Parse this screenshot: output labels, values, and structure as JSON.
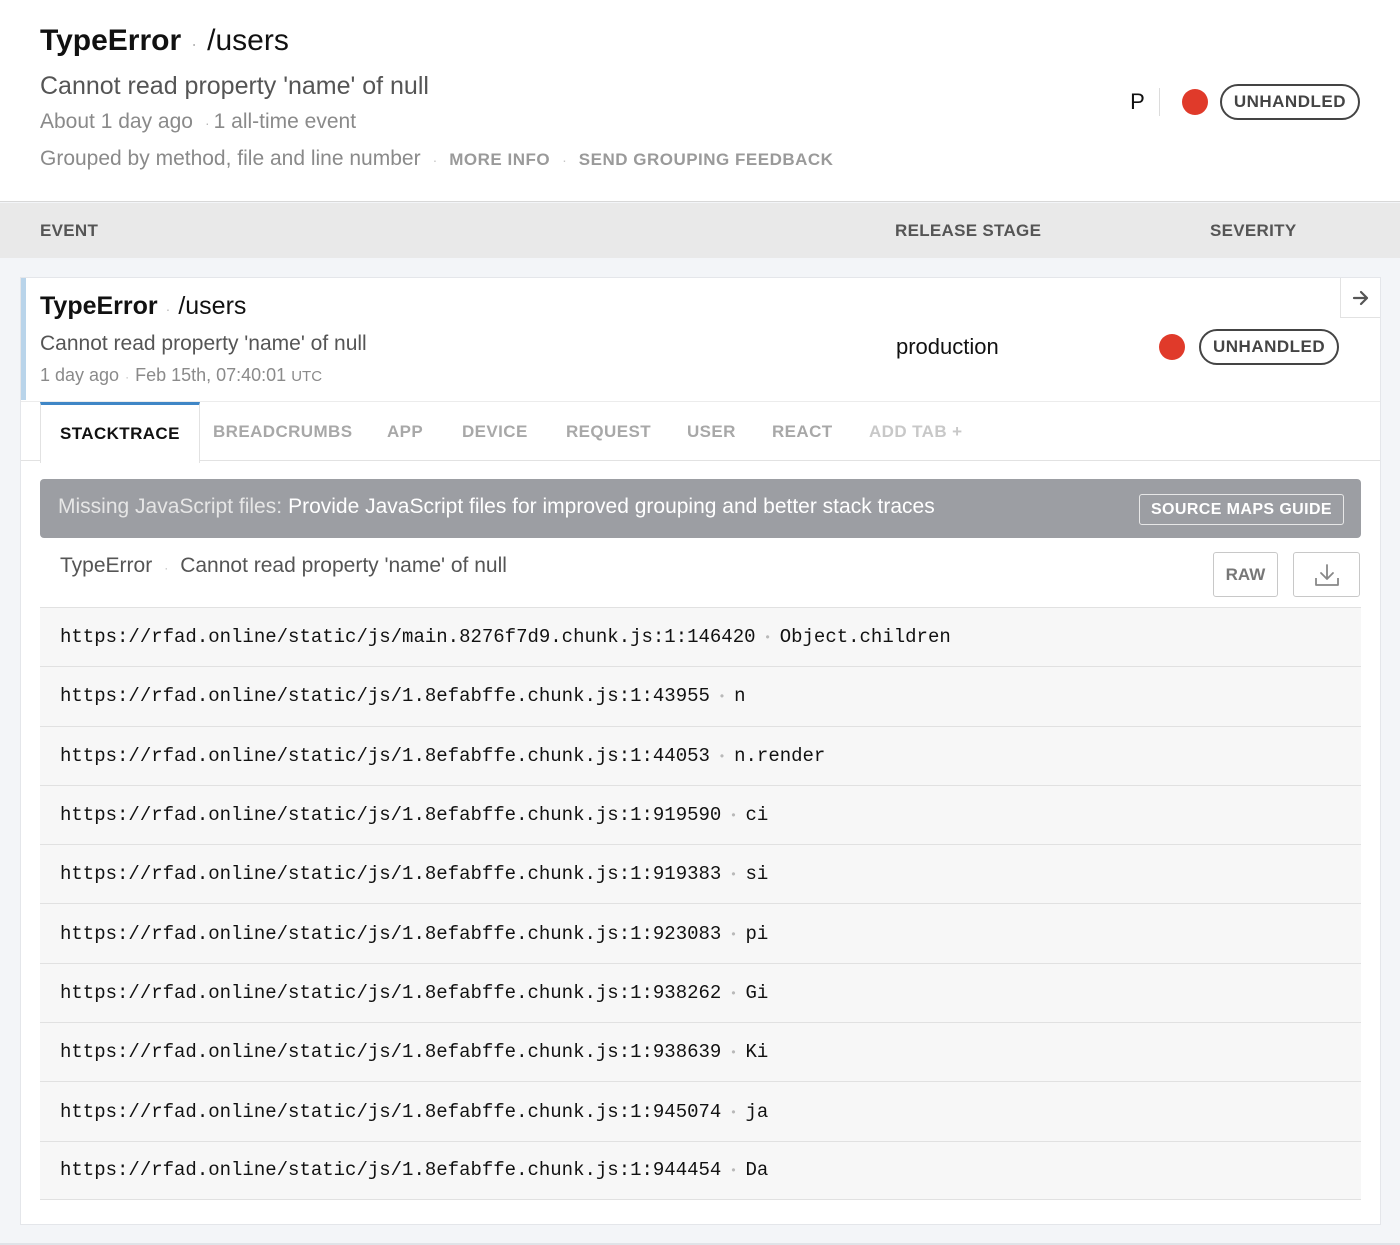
{
  "header": {
    "error_class": "TypeError",
    "context": "/users",
    "message": "Cannot read property 'name' of null",
    "time_ago": "About 1 day ago",
    "event_count": "1 all-time event",
    "grouping_text": "Grouped by method, file and line number",
    "more_info": "MORE INFO",
    "grouping_feedback": "SEND GROUPING FEEDBACK",
    "priority": "P",
    "severity_color": "#e03a2a",
    "status": "UNHANDLED"
  },
  "table_header": {
    "event": "EVENT",
    "release_stage": "RELEASE STAGE",
    "severity": "SEVERITY"
  },
  "event": {
    "error_class": "TypeError",
    "context": "/users",
    "message": "Cannot read property 'name' of null",
    "time_ago": "1 day ago",
    "timestamp": "Feb 15th, 07:40:01",
    "timezone": "UTC",
    "release_stage": "production",
    "status": "UNHANDLED",
    "arrow_icon": "arrow-right-icon"
  },
  "tabs": [
    {
      "label": "STACKTRACE",
      "active": true
    },
    {
      "label": "BREADCRUMBS"
    },
    {
      "label": "APP"
    },
    {
      "label": "DEVICE"
    },
    {
      "label": "REQUEST"
    },
    {
      "label": "USER"
    },
    {
      "label": "REACT"
    },
    {
      "label": "ADD TAB +"
    }
  ],
  "banner": {
    "heading": "Missing JavaScript files:",
    "text": "Provide JavaScript files for improved grouping and better stack traces",
    "button": "SOURCE MAPS GUIDE"
  },
  "stacktrace": {
    "error_class": "TypeError",
    "message": "Cannot read property 'name' of null",
    "raw_label": "RAW",
    "download_icon": "download-icon",
    "frames": [
      {
        "file": "https://rfad.online/static/js/main.8276f7d9.chunk.js:1:146420",
        "method": "Object.children"
      },
      {
        "file": "https://rfad.online/static/js/1.8efabffe.chunk.js:1:43955",
        "method": "n"
      },
      {
        "file": "https://rfad.online/static/js/1.8efabffe.chunk.js:1:44053",
        "method": "n.render"
      },
      {
        "file": "https://rfad.online/static/js/1.8efabffe.chunk.js:1:919590",
        "method": "ci"
      },
      {
        "file": "https://rfad.online/static/js/1.8efabffe.chunk.js:1:919383",
        "method": "si"
      },
      {
        "file": "https://rfad.online/static/js/1.8efabffe.chunk.js:1:923083",
        "method": "pi"
      },
      {
        "file": "https://rfad.online/static/js/1.8efabffe.chunk.js:1:938262",
        "method": "Gi"
      },
      {
        "file": "https://rfad.online/static/js/1.8efabffe.chunk.js:1:938639",
        "method": "Ki"
      },
      {
        "file": "https://rfad.online/static/js/1.8efabffe.chunk.js:1:945074",
        "method": "ja"
      },
      {
        "file": "https://rfad.online/static/js/1.8efabffe.chunk.js:1:944454",
        "method": "Da"
      }
    ]
  }
}
